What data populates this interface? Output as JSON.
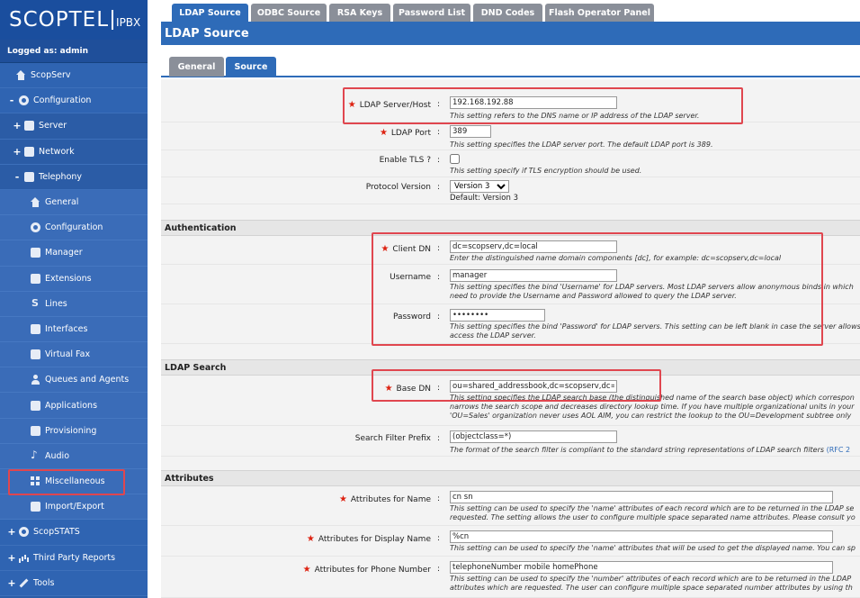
{
  "logo": {
    "brand": "SCOPTEL",
    "suffix": "IPBX"
  },
  "logged_in": "Logged as: admin",
  "sidebar": {
    "items": [
      {
        "label": "ScopServ",
        "pm": "",
        "icon": "house-icon"
      },
      {
        "label": "Configuration",
        "pm": "-",
        "icon": "gear-icon"
      },
      {
        "label": "Server",
        "pm": "+",
        "icon": "server-icon"
      },
      {
        "label": "Network",
        "pm": "+",
        "icon": "network-icon"
      },
      {
        "label": "Telephony",
        "pm": "-",
        "icon": "phone-icon"
      },
      {
        "label": "General",
        "pm": "",
        "icon": "house-icon"
      },
      {
        "label": "Configuration",
        "pm": "",
        "icon": "gear-icon"
      },
      {
        "label": "Manager",
        "pm": "",
        "icon": "manager-icon"
      },
      {
        "label": "Extensions",
        "pm": "",
        "icon": "extensions-icon"
      },
      {
        "label": "Lines",
        "pm": "",
        "icon": "lines-icon"
      },
      {
        "label": "Interfaces",
        "pm": "",
        "icon": "interfaces-icon"
      },
      {
        "label": "Virtual Fax",
        "pm": "",
        "icon": "fax-icon"
      },
      {
        "label": "Queues and Agents",
        "pm": "",
        "icon": "person-icon"
      },
      {
        "label": "Applications",
        "pm": "",
        "icon": "applications-icon"
      },
      {
        "label": "Provisioning",
        "pm": "",
        "icon": "provisioning-icon"
      },
      {
        "label": "Audio",
        "pm": "",
        "icon": "music-note-icon"
      },
      {
        "label": "Miscellaneous",
        "pm": "",
        "icon": "grid-icon"
      },
      {
        "label": "Import/Export",
        "pm": "",
        "icon": "import-export-icon"
      },
      {
        "label": "ScopSTATS",
        "pm": "+",
        "icon": "gear-icon"
      },
      {
        "label": "Third Party Reports",
        "pm": "+",
        "icon": "chart-icon"
      },
      {
        "label": "Tools",
        "pm": "+",
        "icon": "wrench-icon"
      }
    ]
  },
  "top_tabs": [
    "LDAP Source",
    "ODBC Source",
    "RSA Keys",
    "Password List",
    "DND Codes",
    "Flash Operator Panel"
  ],
  "page_title": "LDAP Source",
  "sub_tabs": [
    "General",
    "Source"
  ],
  "colors": {
    "accent": "#2e6bb8",
    "sidebar": "#2c5ea8",
    "highlight": "#e0464f",
    "required": "#dd2211"
  },
  "form": {
    "server_host": {
      "label": "LDAP Server/Host",
      "value": "192.168.192.88",
      "help": "This setting refers to the DNS name or IP address of the LDAP server."
    },
    "port": {
      "label": "LDAP Port",
      "value": "389",
      "help": "This setting specifies the LDAP server port. The default LDAP port is 389."
    },
    "tls": {
      "label": "Enable TLS ?",
      "help": "This setting specify if TLS encryption should be used."
    },
    "protocol": {
      "label": "Protocol Version",
      "value": "Version 3",
      "default": "Default: Version 3"
    },
    "auth_section": "Authentication",
    "client_dn": {
      "label": "Client DN",
      "value": "dc=scopserv,dc=local",
      "help": "Enter the distinguished name domain components [dc], for example: dc=scopserv,dc=local"
    },
    "username": {
      "label": "Username",
      "value": "manager",
      "help1": "This setting specifies the bind 'Username' for LDAP servers. Most LDAP servers allow anonymous binds in which",
      "help2": "need to provide the Username and Password allowed to query the LDAP server."
    },
    "password": {
      "label": "Password",
      "value": "••••••••",
      "help1": "This setting specifies the bind 'Password' for LDAP servers. This setting can be left blank in case the server allows",
      "help2": "access the LDAP server."
    },
    "search_section": "LDAP Search",
    "base_dn": {
      "label": "Base DN",
      "value": "ou=shared_addressbook,dc=scopserv,dc=l",
      "help1": "This setting specifies the LDAP search base (the distinguished name of the search base object) which correspon",
      "help2": "narrows the search scope and decreases directory lookup time. If you have multiple organizational units in your",
      "help3": "'OU=Sales' organization never uses AOL AIM, you can restrict the lookup to the OU=Development subtree only"
    },
    "filter": {
      "label": "Search Filter Prefix",
      "value": "(objectclass=*)",
      "help": "The format of the search filter is compliant to the standard string representations of LDAP search filters",
      "link": "(RFC 2"
    },
    "attr_section": "Attributes",
    "attr_name": {
      "label": "Attributes for Name",
      "value": "cn sn",
      "help1": "This setting can be used to specify the 'name' attributes of each record which are to be returned in the LDAP se",
      "help2": "requested. The setting allows the user to configure multiple space separated name attributes. Please consult yo"
    },
    "attr_display": {
      "label": "Attributes for Display Name",
      "value": "%cn",
      "help": "This setting can be used to specify the 'name' attributes that will be used to get the displayed name. You can sp"
    },
    "attr_phone": {
      "label": "Attributes for Phone Number",
      "value": "telephoneNumber mobile homePhone",
      "help1": "This setting can be used to specify the 'number' attributes of each record which are to be returned in the LDAP",
      "help2": "attributes which are requested. The user can configure multiple space separated number attributes by using th"
    }
  }
}
